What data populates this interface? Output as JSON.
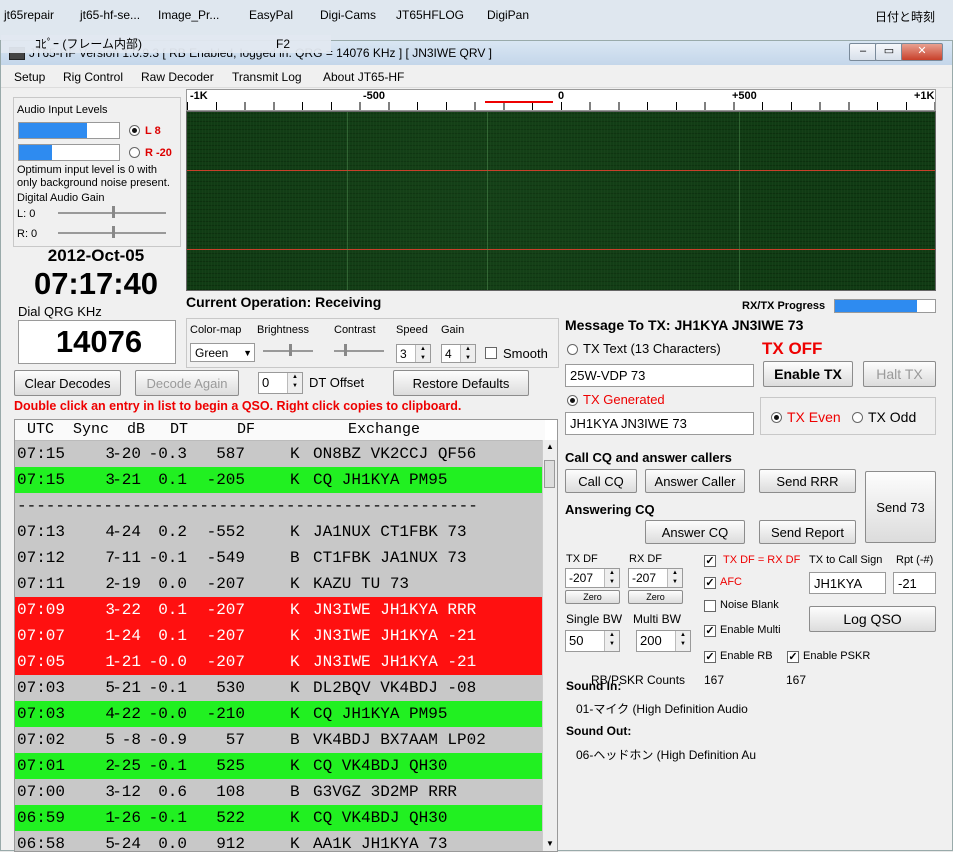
{
  "desktop": {
    "icons": [
      "jt65repair",
      "jt65-hf-se...",
      "Image_Pr...",
      "EasyPal",
      "Digi-Cams",
      "JT65HFLOG",
      "DigiPan"
    ],
    "clock": "日付と時刻",
    "ghost_title": "ｺﾋﾟｰ (フレーム内部)",
    "ghost_key": "F2"
  },
  "window": {
    "title": "JT65-HF Version 1.0.9.3   [ RB Enabled, logged in.  QRG = 14076 KHz ] [ JN3IWE QRV ]",
    "controls": [
      "–",
      "▭",
      "✕"
    ]
  },
  "menu": [
    "Setup",
    "Rig Control",
    "Raw Decoder",
    "Transmit Log",
    "About JT65-HF"
  ],
  "audio": {
    "title": "Audio Input Levels",
    "left_label": "L 8",
    "right_label": "R -20",
    "left_level": 0.68,
    "right_level": 0.33,
    "note": "Optimum input level is 0 with only background noise present.",
    "gain_title": "Digital Audio Gain",
    "gain_l": "L: 0",
    "gain_r": "R: 0"
  },
  "datetime": {
    "date": "2012-Oct-05",
    "time": "07:17:40"
  },
  "dial": {
    "label": "Dial QRG KHz",
    "value": "14076"
  },
  "ruler": [
    "-1K",
    "-500",
    "0",
    "+500",
    "+1K"
  ],
  "current_operation": {
    "label": "Current Operation:",
    "value": "Receiving"
  },
  "display": {
    "colormap_label": "Color-map",
    "colormap_value": "Green",
    "brightness_label": "Brightness",
    "contrast_label": "Contrast",
    "speed_label": "Speed",
    "speed_value": "3",
    "gain_label": "Gain",
    "gain_value": "4",
    "smooth_label": "Smooth"
  },
  "buttons": {
    "clear_decodes": "Clear Decodes",
    "decode_again": "Decode Again",
    "dt_offset_value": "0",
    "dt_offset_label": "DT Offset",
    "restore_defaults": "Restore Defaults"
  },
  "instruction": "Double click an entry in list to begin a QSO.  Right click copies to clipboard.",
  "decode_columns": [
    "UTC",
    "Sync",
    "dB",
    "DT",
    "DF",
    "Exchange"
  ],
  "decodes": [
    {
      "utc": "07:15",
      "sync": "3",
      "db": "-20",
      "dt": "-0.3",
      "df": "587",
      "mode": "K",
      "msg": "ON8BZ VK2CCJ QF56",
      "color": "gray"
    },
    {
      "utc": "07:15",
      "sync": "3",
      "db": "-21",
      "dt": "0.1",
      "df": "-205",
      "mode": "K",
      "msg": "CQ JH1KYA PM95",
      "color": "green"
    },
    {
      "separator": "------------------------------------------------",
      "color": "gray"
    },
    {
      "utc": "07:13",
      "sync": "4",
      "db": "-24",
      "dt": "0.2",
      "df": "-552",
      "mode": "K",
      "msg": "JA1NUX CT1FBK 73",
      "color": "gray"
    },
    {
      "utc": "07:12",
      "sync": "7",
      "db": "-11",
      "dt": "-0.1",
      "df": "-549",
      "mode": "B",
      "msg": "CT1FBK JA1NUX 73",
      "color": "gray"
    },
    {
      "utc": "07:11",
      "sync": "2",
      "db": "-19",
      "dt": "0.0",
      "df": "-207",
      "mode": "K",
      "msg": "KAZU TU 73",
      "color": "gray"
    },
    {
      "utc": "07:09",
      "sync": "3",
      "db": "-22",
      "dt": "0.1",
      "df": "-207",
      "mode": "K",
      "msg": "JN3IWE JH1KYA RRR",
      "color": "red"
    },
    {
      "utc": "07:07",
      "sync": "1",
      "db": "-24",
      "dt": "0.1",
      "df": "-207",
      "mode": "K",
      "msg": "JN3IWE JH1KYA -21",
      "color": "red"
    },
    {
      "utc": "07:05",
      "sync": "1",
      "db": "-21",
      "dt": "-0.0",
      "df": "-207",
      "mode": "K",
      "msg": "JN3IWE JH1KYA -21",
      "color": "red"
    },
    {
      "utc": "07:03",
      "sync": "5",
      "db": "-21",
      "dt": "-0.1",
      "df": "530",
      "mode": "K",
      "msg": "DL2BQV VK4BDJ -08",
      "color": "gray"
    },
    {
      "utc": "07:03",
      "sync": "4",
      "db": "-22",
      "dt": "-0.0",
      "df": "-210",
      "mode": "K",
      "msg": "CQ JH1KYA PM95",
      "color": "green"
    },
    {
      "utc": "07:02",
      "sync": "5",
      "db": "-8",
      "dt": "-0.9",
      "df": "57",
      "mode": "B",
      "msg": "VK4BDJ BX7AAM LP02",
      "color": "gray"
    },
    {
      "utc": "07:01",
      "sync": "2",
      "db": "-25",
      "dt": "-0.1",
      "df": "525",
      "mode": "K",
      "msg": "CQ VK4BDJ QH30",
      "color": "green"
    },
    {
      "utc": "07:00",
      "sync": "3",
      "db": "-12",
      "dt": "0.6",
      "df": "108",
      "mode": "B",
      "msg": "G3VGZ 3D2MP RRR",
      "color": "gray"
    },
    {
      "utc": "06:59",
      "sync": "1",
      "db": "-26",
      "dt": "-0.1",
      "df": "522",
      "mode": "K",
      "msg": "CQ VK4BDJ QH30",
      "color": "green"
    },
    {
      "utc": "06:58",
      "sync": "5",
      "db": "-24",
      "dt": "0.0",
      "df": "912",
      "mode": "K",
      "msg": "AA1K JH1KYA 73",
      "color": "gray"
    }
  ],
  "tx": {
    "progress_label": "RX/TX Progress",
    "progress_value": 0.82,
    "message_label": "Message To TX:",
    "message_value": "JH1KYA JN3IWE 73",
    "tx_text_label": "TX Text (13 Characters)",
    "tx_off": "TX OFF",
    "tx_text_value": "25W-VDP 73",
    "enable_tx": "Enable TX",
    "halt_tx": "Halt TX",
    "tx_generated_label": "TX Generated",
    "tx_generated_value": "JH1KYA JN3IWE 73",
    "tx_even": "TX Even",
    "tx_odd": "TX Odd"
  },
  "cq": {
    "section_label": "Call CQ and answer callers",
    "call_cq": "Call CQ",
    "answer_caller": "Answer Caller",
    "send_rrr": "Send RRR",
    "send_73": "Send 73",
    "answering_label": "Answering CQ",
    "answer_cq": "Answer CQ",
    "send_report": "Send Report"
  },
  "df": {
    "tx_df_label": "TX DF",
    "tx_df_value": "-207",
    "rx_df_label": "RX DF",
    "rx_df_value": "-207",
    "zero": "Zero",
    "txdf_eq_rxdf": "TX DF = RX DF",
    "afc": "AFC",
    "noise_blank": "Noise Blank",
    "enable_multi": "Enable Multi",
    "enable_rb": "Enable RB",
    "enable_pskr": "Enable PSKR",
    "single_bw_label": "Single BW",
    "single_bw_value": "50",
    "multi_bw_label": "Multi BW",
    "multi_bw_value": "200",
    "to_call_label": "TX to Call Sign",
    "to_call_value": "JH1KYA",
    "rpt_label": "Rpt (-#)",
    "rpt_value": "-21",
    "log_qso": "Log QSO"
  },
  "counts": {
    "label": "RB/PSKR Counts",
    "rb": "167",
    "pskr": "167"
  },
  "sound": {
    "in_label": "Sound In:",
    "in_value": "01-マイク (High Definition Audio",
    "out_label": "Sound Out:",
    "out_value": "06-ヘッドホン (High Definition Au"
  }
}
